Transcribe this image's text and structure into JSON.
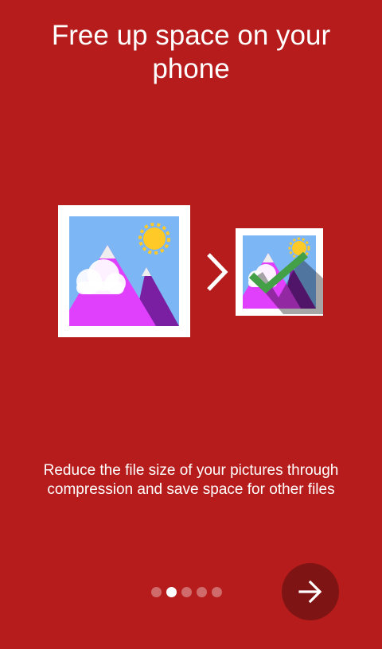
{
  "onboarding": {
    "title": "Free up space on your phone",
    "description": "Reduce the file size of your pictures through compression and save space for other files",
    "page_indicator": {
      "total": 5,
      "active_index": 1
    },
    "next_button": {
      "icon": "arrow-right-icon"
    },
    "illustration": {
      "before_icon": "picture-icon",
      "separator_icon": "chevron-right-icon",
      "after_icon": "compressed-picture-check-icon"
    }
  },
  "colors": {
    "background": "#b71c1c",
    "next_button": "#7f1414",
    "check_mark": "#43a047"
  }
}
